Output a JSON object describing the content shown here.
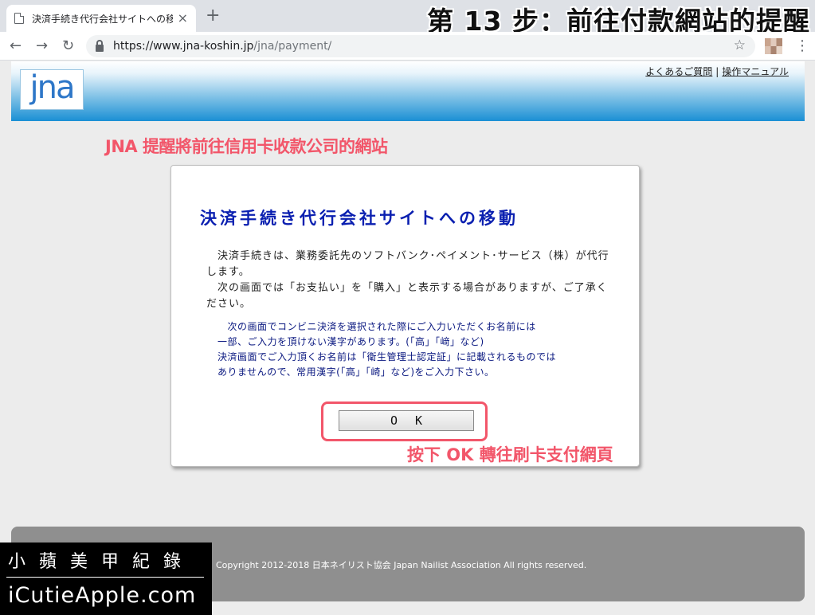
{
  "browser": {
    "tab_title": "決済手続き代行会社サイトへの移",
    "tab_close": "×",
    "new_tab": "+",
    "url_host": "https://www.jna-koshin.jp",
    "url_path": "/jna/payment/",
    "back": "←",
    "forward": "→",
    "reload": "↻",
    "star": "☆",
    "menu": "⋮"
  },
  "overlay": {
    "step_title": "第 13 步：前往付款網站的提醒",
    "annotation_top": "JNA 提醒將前往信用卡收款公司的網站",
    "annotation_ok": "按下 OK 轉往刷卡支付網頁",
    "highlight_color": "#f2566a"
  },
  "header": {
    "logo_text": "jna",
    "link_faq": "よくあるご質問",
    "separator": "|",
    "link_manual": "操作マニュアル"
  },
  "dialog": {
    "title": "決済手続き代行会社サイトへの移動",
    "body_1": "　決済手続きは、業務委託先のソフトバンク･ペイメント･サービス（株）が代行します。",
    "body_2": "　次の画面では「お支払い」を「購入」と表示する場合がありますが、ご了承ください。",
    "note_1": "　次の画面でコンビニ決済を選択された際にご入力いただくお名前には",
    "note_2": "一部、ご入力を頂けない漢字があります。(「高」「﨑」など)",
    "note_3": "決済画面でご入力頂くお名前は「衛生管理士認定証」に記載されるものでは",
    "note_4": "ありませんので、常用漢字(「高」「崎」など)をご入力下さい。",
    "ok_label": "OK"
  },
  "footer": {
    "copyright": "Copyright 2012-2018 日本ネイリスト協会 Japan Nailist Association All rights reserved."
  },
  "watermark": {
    "line1": "小蘋美甲紀錄",
    "line2": "iCutieApple.com"
  }
}
